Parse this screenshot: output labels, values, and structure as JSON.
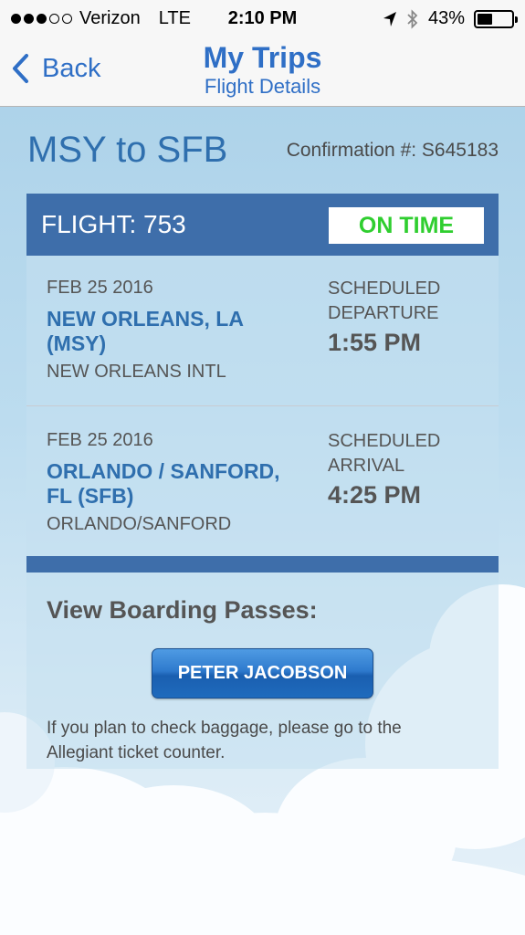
{
  "status_bar": {
    "carrier": "Verizon",
    "network": "LTE",
    "time": "2:10 PM",
    "battery": "43%",
    "signal_bars_filled": 3,
    "signal_bars_total": 5
  },
  "nav": {
    "back_label": "Back",
    "title": "My Trips",
    "subtitle": "Flight Details"
  },
  "trip": {
    "route": "MSY to SFB",
    "confirmation": "Confirmation #: S645183"
  },
  "flight": {
    "label": "FLIGHT: 753",
    "status": "ON TIME",
    "departure": {
      "date": "FEB 25 2016",
      "city_line1": "NEW ORLEANS, LA",
      "city_line2": "(MSY)",
      "airport": "NEW ORLEANS INTL",
      "sched_line1": "SCHEDULED",
      "sched_line2": "DEPARTURE",
      "time": "1:55 PM"
    },
    "arrival": {
      "date": "FEB 25 2016",
      "city_line1": "ORLANDO / SANFORD,",
      "city_line2": "FL (SFB)",
      "airport": "ORLANDO/SANFORD",
      "sched_line1": "SCHEDULED",
      "sched_line2": "ARRIVAL",
      "time": "4:25 PM"
    }
  },
  "boarding": {
    "heading": "View Boarding Passes:",
    "passenger_button": "PETER JACOBSON",
    "note_line1": "If you plan to check baggage, please go to the",
    "note_line2": "Allegiant ticket counter."
  },
  "colors": {
    "accent": "#2f6fc6",
    "header_bar": "#3e6eaa",
    "on_time": "#2fce2f"
  }
}
